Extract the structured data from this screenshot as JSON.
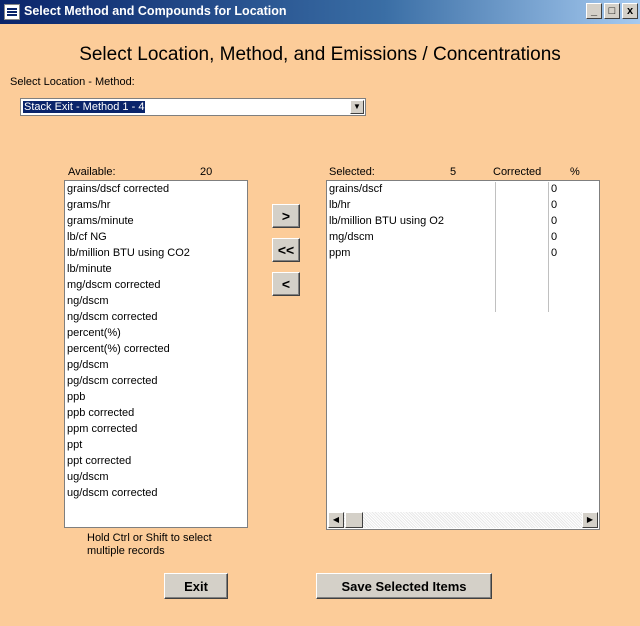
{
  "window": {
    "title": "Select Method and Compounds for Location",
    "controls": {
      "minimize": "_",
      "maximize": "□",
      "close": "x"
    }
  },
  "heading": "Select Location, Method, and Emissions / Concentrations",
  "location_method": {
    "label": "Select Location - Method:",
    "value": "Stack Exit - Method 1 - 4"
  },
  "available": {
    "label": "Available:",
    "count": "20",
    "items": [
      "grains/dscf corrected",
      "grams/hr",
      "grams/minute",
      "lb/cf NG",
      "lb/million BTU using CO2",
      "lb/minute",
      "mg/dscm corrected",
      "ng/dscm",
      "ng/dscm corrected",
      "percent(%)",
      "percent(%) corrected",
      "pg/dscm",
      "pg/dscm corrected",
      "ppb",
      "ppb corrected",
      "ppm corrected",
      "ppt",
      "ppt corrected",
      "ug/dscm",
      "ug/dscm corrected"
    ]
  },
  "selected": {
    "label": "Selected:",
    "count": "5",
    "col_corrected": "Corrected",
    "col_percent": "%",
    "rows": [
      {
        "name": "grains/dscf",
        "percent": "0"
      },
      {
        "name": "lb/hr",
        "percent": "0"
      },
      {
        "name": "lb/million BTU using O2",
        "percent": "0"
      },
      {
        "name": "mg/dscm",
        "percent": "0"
      },
      {
        "name": "ppm",
        "percent": "0"
      }
    ]
  },
  "transfer_buttons": {
    "add": ">",
    "remove_all": "<<",
    "remove": "<"
  },
  "hint": "Hold Ctrl or Shift to select multiple records",
  "buttons": {
    "exit": "Exit",
    "save": "Save Selected Items"
  }
}
